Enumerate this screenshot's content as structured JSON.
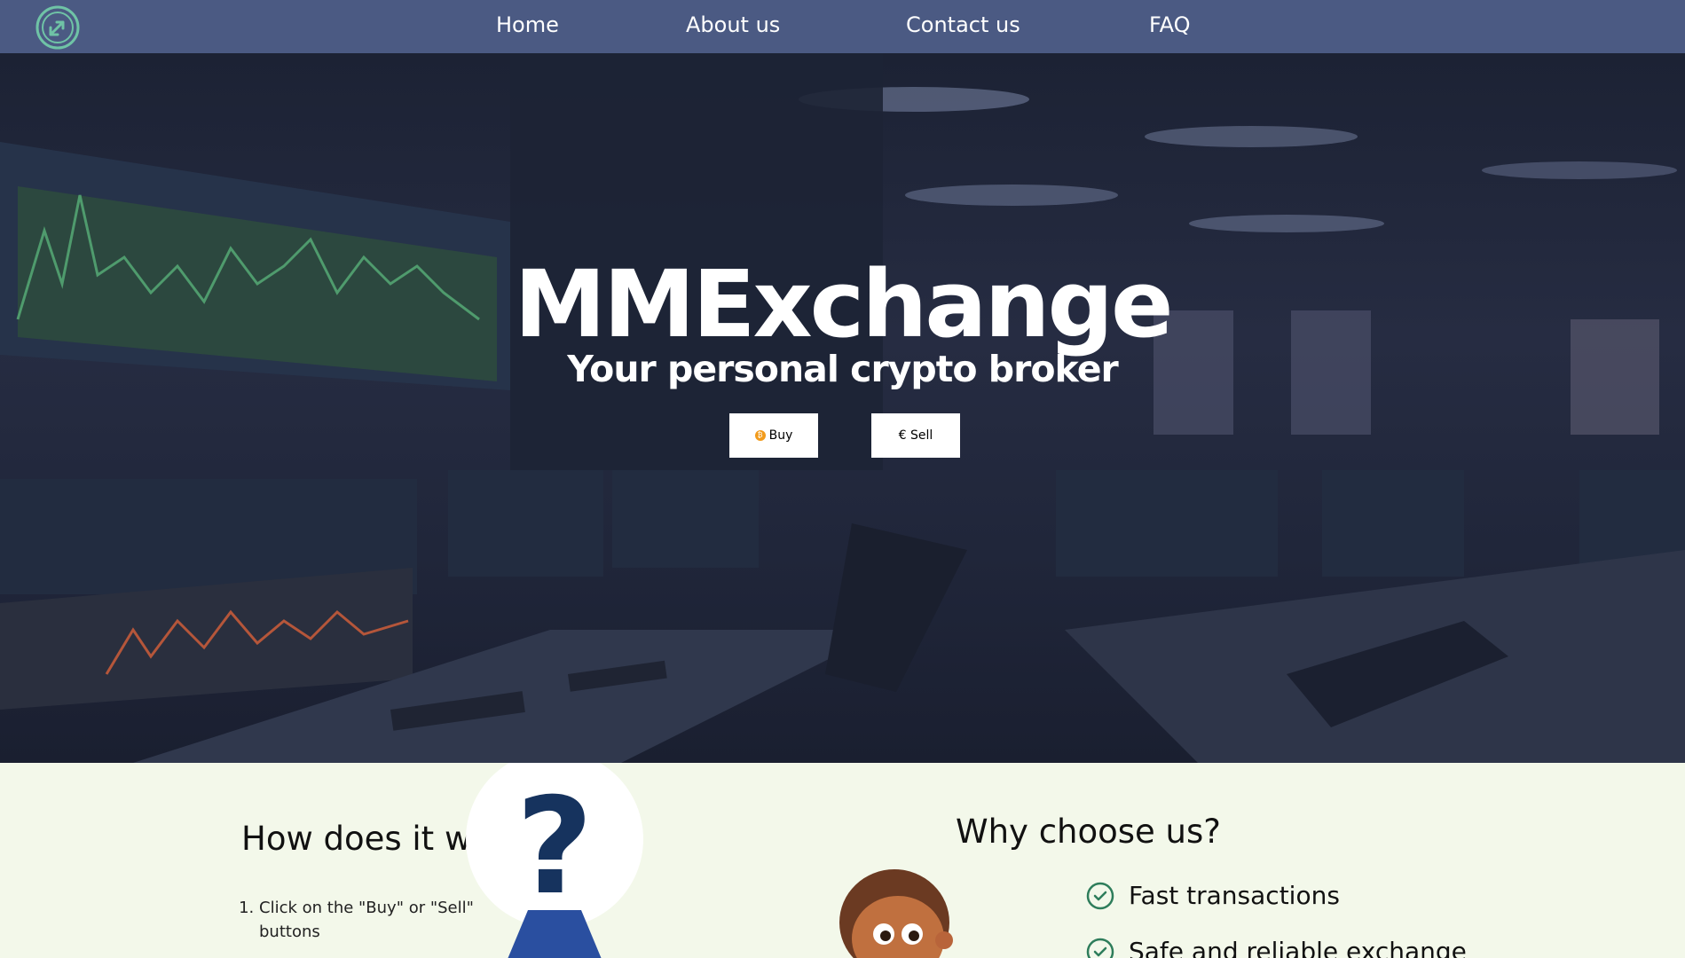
{
  "nav": {
    "logo_icon": "exchange-arrows-logo",
    "links": [
      "Home",
      "About us",
      "Contact us",
      "FAQ"
    ]
  },
  "hero": {
    "title": "MMExchange",
    "subtitle": "Your personal crypto broker",
    "buy_label": "Buy",
    "sell_label": "€ Sell"
  },
  "how_it_works": {
    "title": "How does it work",
    "steps": [
      "Click on the \"Buy\" or \"Sell\" buttons"
    ]
  },
  "why_choose": {
    "title": "Why choose us?",
    "features": [
      "Fast transactions",
      "Safe and reliable exchange"
    ]
  },
  "colors": {
    "nav_bg": "#4b5a83",
    "section_bg": "#f3f8ea",
    "check_green": "#2e7d5b",
    "bitcoin_orange": "#f29b1c"
  }
}
